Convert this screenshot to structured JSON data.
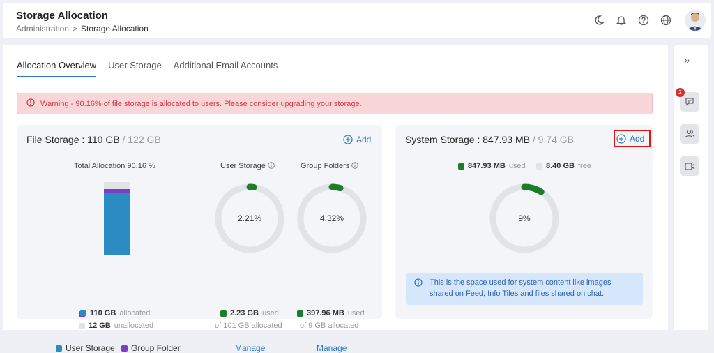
{
  "header": {
    "title": "Storage Allocation",
    "breadcrumb": [
      "Administration",
      "Storage Allocation"
    ],
    "icons": [
      "moon-icon",
      "bell-icon",
      "help-icon",
      "globe-icon",
      "avatar"
    ]
  },
  "tabs": [
    "Allocation Overview",
    "User Storage",
    "Additional Email Accounts"
  ],
  "warning": "Warning - 90.16% of file storage is allocated to users. Please consider upgrading your storage.",
  "file_storage": {
    "title": "File Storage : 110 GB",
    "total": "/ 122 GB",
    "add_label": "Add",
    "total_allocation_label": "Total Allocation 90.16 %",
    "bar": {
      "user_fraction": 0.845,
      "group_fraction": 0.056
    },
    "allocated_value": "110 GB",
    "allocated_label": "allocated",
    "unallocated_value": "12 GB",
    "unallocated_label": "unallocated",
    "legend_user": "User Storage",
    "legend_group": "Group Folder",
    "user_storage": {
      "title": "User Storage",
      "percent_text": "2.21%",
      "percent": 0.0221,
      "used_value": "2.23 GB",
      "used_label": "used",
      "of_text": "of 101 GB allocated",
      "manage": "Manage"
    },
    "group_folders": {
      "title": "Group Folders",
      "percent_text": "4.32%",
      "percent": 0.0432,
      "used_value": "397.96 MB",
      "used_label": "used",
      "of_text": "of 9 GB allocated",
      "manage": "Manage"
    }
  },
  "system_storage": {
    "title": "System Storage : 847.93 MB",
    "total": "/ 9.74 GB",
    "add_label": "Add",
    "used_value": "847.93 MB",
    "used_label": "used",
    "free_value": "8.40 GB",
    "free_label": "free",
    "percent_text": "9%",
    "percent": 0.09,
    "info_line1": "This is the space used for system content like images",
    "info_line2": "shared on Feed, Info Tiles and files shared on chat."
  },
  "right_sidebar": {
    "notification_count": "2"
  },
  "colors": {
    "accent": "#2b78c5",
    "user_storage": "#2b8cc4",
    "group_folder": "#7b3fc4",
    "used_green": "#1e7d2d",
    "warning_text": "#d9364a"
  }
}
